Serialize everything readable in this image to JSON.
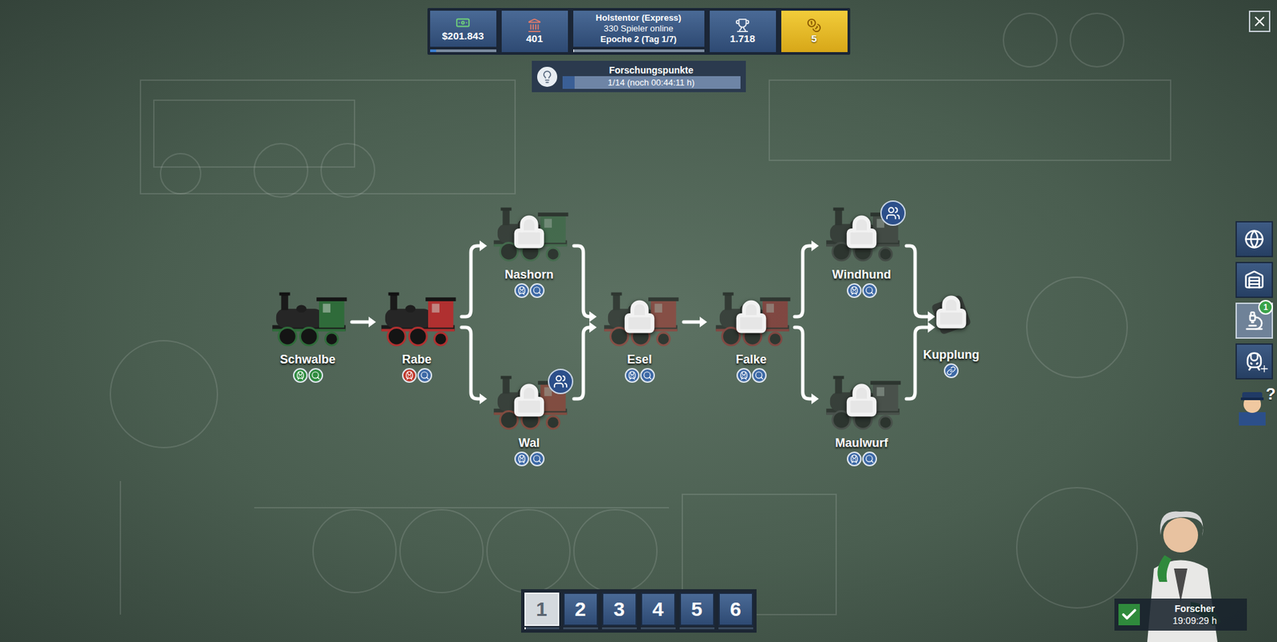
{
  "top_bar": {
    "money": {
      "value": "$201.843",
      "level": 0.1
    },
    "prestige": {
      "value": "401"
    },
    "server": {
      "name": "Holstentor (Express)",
      "players": "330 Spieler online",
      "epoch": "Epoche 2 (Tag 1/7)",
      "level": 0.01
    },
    "rank": {
      "value": "1.718"
    },
    "gold": {
      "value": "5"
    }
  },
  "research_points": {
    "title": "Forschungspunkte",
    "reading": "1/14 (noch 00:44:11 h)",
    "level": 0.07
  },
  "nodes": [
    {
      "name": "Schwalbe",
      "kind": "locomotive",
      "locked": false,
      "group_bonus": false,
      "color": "#2f6b3a",
      "badges": [
        {
          "kind": "train",
          "color": "#2e8b3e"
        },
        {
          "kind": "research",
          "color": "#2e8b3e"
        }
      ]
    },
    {
      "name": "Rabe",
      "kind": "locomotive",
      "locked": false,
      "group_bonus": false,
      "color": "#b03030",
      "badges": [
        {
          "kind": "train",
          "color": "#c0392b"
        },
        {
          "kind": "research",
          "color": "#3d69a6"
        }
      ]
    },
    {
      "name": "Nashorn",
      "kind": "locomotive",
      "locked": true,
      "group_bonus": false,
      "color": "#3a6b45",
      "badges": [
        {
          "kind": "train",
          "color": "#3d69a6"
        },
        {
          "kind": "research",
          "color": "#3d69a6"
        }
      ]
    },
    {
      "name": "Wal",
      "kind": "locomotive",
      "locked": true,
      "group_bonus": true,
      "color": "#9e3a30",
      "badges": [
        {
          "kind": "train",
          "color": "#3d69a6"
        },
        {
          "kind": "research",
          "color": "#3d69a6"
        }
      ]
    },
    {
      "name": "Esel",
      "kind": "locomotive",
      "locked": true,
      "group_bonus": false,
      "color": "#a33a35",
      "badges": [
        {
          "kind": "train",
          "color": "#3d69a6"
        },
        {
          "kind": "research",
          "color": "#3d69a6"
        }
      ]
    },
    {
      "name": "Falke",
      "kind": "locomotive",
      "locked": true,
      "group_bonus": false,
      "color": "#9b3030",
      "badges": [
        {
          "kind": "train",
          "color": "#3d69a6"
        },
        {
          "kind": "research",
          "color": "#3d69a6"
        }
      ]
    },
    {
      "name": "Windhund",
      "kind": "locomotive",
      "locked": true,
      "group_bonus": true,
      "color": "#3a3a3a",
      "badges": [
        {
          "kind": "train",
          "color": "#3d69a6"
        },
        {
          "kind": "research",
          "color": "#3d69a6"
        }
      ]
    },
    {
      "name": "Maulwurf",
      "kind": "locomotive",
      "locked": true,
      "group_bonus": false,
      "color": "#444444",
      "badges": [
        {
          "kind": "train",
          "color": "#3d69a6"
        },
        {
          "kind": "research",
          "color": "#3d69a6"
        }
      ]
    },
    {
      "name": "Kupplung",
      "kind": "coupling",
      "locked": true,
      "group_bonus": false,
      "color": "#2b2b2b",
      "badges": [
        {
          "kind": "link",
          "color": "#3d69a6"
        }
      ]
    }
  ],
  "side_menu": [
    {
      "kind": "globe",
      "selected": false
    },
    {
      "kind": "station",
      "selected": false
    },
    {
      "kind": "research",
      "selected": true,
      "badge": "1"
    },
    {
      "kind": "train",
      "selected": false
    },
    {
      "kind": "help",
      "selected": false,
      "text": "?"
    }
  ],
  "pages": [
    {
      "label": "1",
      "selected": true,
      "level": 0.05
    },
    {
      "label": "2",
      "selected": false,
      "level": 0
    },
    {
      "label": "3",
      "selected": false,
      "level": 0
    },
    {
      "label": "4",
      "selected": false,
      "level": 0
    },
    {
      "label": "5",
      "selected": false,
      "level": 0
    },
    {
      "label": "6",
      "selected": false,
      "level": 0
    }
  ],
  "researcher": {
    "label": "Forscher",
    "time": "19:09:29 h",
    "active": true
  }
}
